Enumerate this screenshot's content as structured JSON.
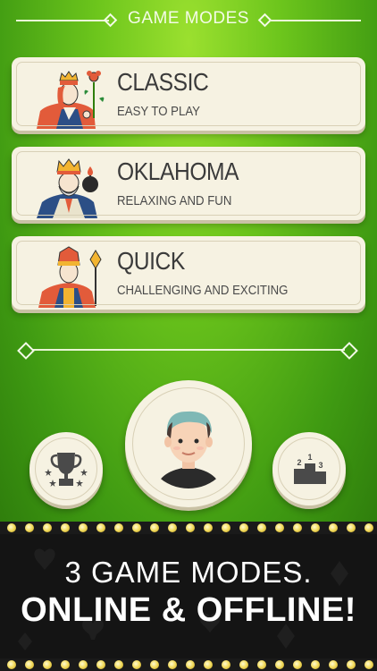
{
  "header": {
    "title": "GAME MODES"
  },
  "modes": [
    {
      "title": "CLASSIC",
      "subtitle": "EASY TO PLAY",
      "icon": "queen-card-icon"
    },
    {
      "title": "OKLAHOMA",
      "subtitle": "RELAXING AND FUN",
      "icon": "king-card-icon"
    },
    {
      "title": "QUICK",
      "subtitle": "CHALLENGING AND EXCITING",
      "icon": "jack-card-icon"
    }
  ],
  "bottom": {
    "left_icon": "trophy-icon",
    "center_icon": "player-avatar",
    "right_icon": "leaderboard-podium-icon",
    "podium_labels": [
      "2",
      "1",
      "3"
    ]
  },
  "banner": {
    "line1": "3 GAME MODES.",
    "line2": "ONLINE & OFFLINE!"
  },
  "colors": {
    "background_green": "#6cc51c",
    "card": "#f6f2e2",
    "banner": "#151515",
    "bulb": "#f2da5a"
  }
}
